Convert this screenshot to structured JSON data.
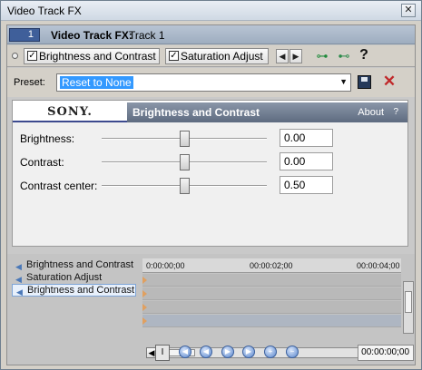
{
  "window": {
    "title": "Video Track FX",
    "close_glyph": "✕"
  },
  "header": {
    "track_number": "1",
    "label": "Video Track FX:",
    "track_name": "Track 1"
  },
  "chain": {
    "plugins": [
      {
        "label": "Brightness and Contrast",
        "checked": true
      },
      {
        "label": "Saturation Adjust",
        "checked": true
      }
    ],
    "prev_glyph": "◀",
    "next_glyph": "▶",
    "help_glyph": "?"
  },
  "preset": {
    "label": "Preset:",
    "value": "Reset to None"
  },
  "plugin_panel": {
    "brand": "SONY.",
    "title": "Brightness and Contrast",
    "about": "About",
    "help": "?",
    "params": [
      {
        "label": "Brightness:",
        "value": "0.00",
        "fraction": 0.5
      },
      {
        "label": "Contrast:",
        "value": "0.00",
        "fraction": 0.5
      },
      {
        "label": "Contrast center:",
        "value": "0.50",
        "fraction": 0.5
      }
    ]
  },
  "keyframes": {
    "chain_items": [
      {
        "label": "Brightness and Contrast",
        "selected": false
      },
      {
        "label": "Saturation Adjust",
        "selected": false
      },
      {
        "label": "Brightness and Contrast",
        "selected": true
      }
    ],
    "ruler_times": [
      "0:00:00;00",
      "00:00:02;00",
      "00:00:04;00"
    ],
    "cursor_timecode": "00:00:00;00"
  },
  "colors": {
    "accent": "#3f5f9a",
    "selection": "#3399ff",
    "delete": "#c0282a"
  }
}
